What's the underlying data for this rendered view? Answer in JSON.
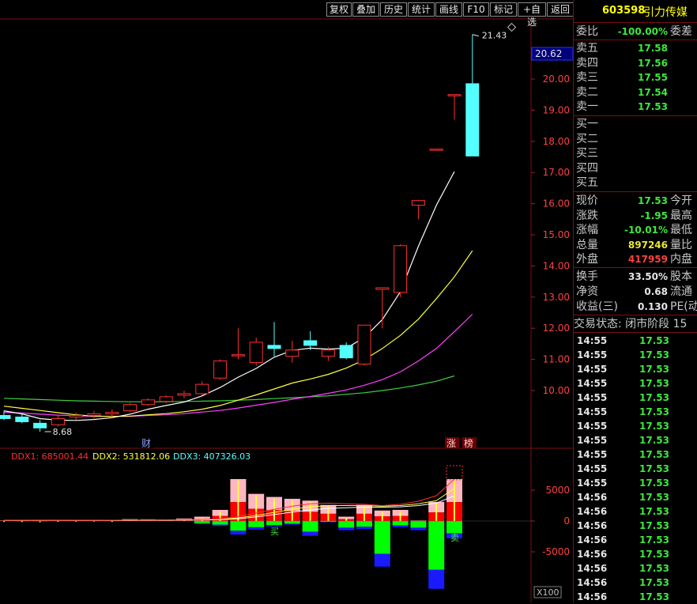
{
  "toolbar": {
    "buttons": [
      "复权",
      "叠加",
      "历史",
      "统计",
      "画线",
      "F10",
      "标记",
      "+自选",
      "返回"
    ]
  },
  "stock": {
    "code": "603598",
    "name": "引力传媒"
  },
  "price_axis": {
    "labels": [
      "20.00",
      "19.00",
      "18.00",
      "17.00",
      "16.00",
      "15.00",
      "14.00",
      "13.00",
      "12.00",
      "11.00",
      "10.00"
    ],
    "current_label": "20.62"
  },
  "chart_annotations": {
    "high_label": "21.43",
    "low_label": "8.68",
    "marker_cai": "财",
    "marker_zhang": "涨",
    "marker_bang": "榜",
    "buy_marker": "买",
    "sell_marker": "卖"
  },
  "ddx": {
    "ddx1_label": "DDX1: 685001.44",
    "ddx2_label": "DDX2: 531812.06",
    "ddx3_label": "DDX3: 407326.03",
    "axis_labels": [
      "5000",
      "0",
      "-5000"
    ],
    "scale_label": "X100"
  },
  "colors": {
    "up": "#ff3030",
    "down": "#54ffff",
    "ma5": "#ffffff",
    "ma10": "#ffff40",
    "ma20": "#ff40ff",
    "ma60": "#40d040",
    "ddx_up_dark": "#ff0000",
    "ddx_up_light": "#ffb6c1",
    "ddx_dn_dark": "#1a1aff",
    "ddx_dn_light": "#00ff00"
  },
  "chart_data": {
    "type": "candlestick",
    "candles": [
      {
        "o": 9.2,
        "h": 9.35,
        "l": 9.05,
        "c": 9.1
      },
      {
        "o": 9.15,
        "h": 9.25,
        "l": 8.95,
        "c": 9.0
      },
      {
        "o": 8.95,
        "h": 9.05,
        "l": 8.68,
        "c": 8.8
      },
      {
        "o": 8.9,
        "h": 9.2,
        "l": 8.85,
        "c": 9.1
      },
      {
        "o": 9.15,
        "h": 9.3,
        "l": 9.05,
        "c": 9.2
      },
      {
        "o": 9.2,
        "h": 9.35,
        "l": 9.1,
        "c": 9.25
      },
      {
        "o": 9.25,
        "h": 9.4,
        "l": 9.15,
        "c": 9.3
      },
      {
        "o": 9.35,
        "h": 9.6,
        "l": 9.3,
        "c": 9.55
      },
      {
        "o": 9.55,
        "h": 9.75,
        "l": 9.5,
        "c": 9.7
      },
      {
        "o": 9.65,
        "h": 9.85,
        "l": 9.6,
        "c": 9.8
      },
      {
        "o": 9.85,
        "h": 10.0,
        "l": 9.75,
        "c": 9.9
      },
      {
        "o": 9.9,
        "h": 10.3,
        "l": 9.85,
        "c": 10.2
      },
      {
        "o": 10.4,
        "h": 11.0,
        "l": 10.35,
        "c": 10.95
      },
      {
        "o": 11.15,
        "h": 12.0,
        "l": 11.0,
        "c": 11.15
      },
      {
        "o": 10.9,
        "h": 11.7,
        "l": 10.8,
        "c": 11.55
      },
      {
        "o": 11.45,
        "h": 12.2,
        "l": 11.1,
        "c": 11.35
      },
      {
        "o": 11.1,
        "h": 11.6,
        "l": 10.9,
        "c": 11.3
      },
      {
        "o": 11.6,
        "h": 11.9,
        "l": 11.3,
        "c": 11.45
      },
      {
        "o": 11.1,
        "h": 11.4,
        "l": 10.95,
        "c": 11.3
      },
      {
        "o": 11.45,
        "h": 11.55,
        "l": 11.0,
        "c": 11.05
      },
      {
        "o": 10.85,
        "h": 12.1,
        "l": 10.8,
        "c": 12.1
      },
      {
        "o": 13.25,
        "h": 13.3,
        "l": 12.0,
        "c": 13.3
      },
      {
        "o": 13.15,
        "h": 14.7,
        "l": 13.0,
        "c": 14.65
      },
      {
        "o": 15.95,
        "h": 16.1,
        "l": 15.5,
        "c": 16.1
      },
      {
        "o": 17.75,
        "h": 17.75,
        "l": 17.75,
        "c": 17.75
      },
      {
        "o": 19.5,
        "h": 19.5,
        "l": 18.7,
        "c": 19.5
      },
      {
        "o": 19.85,
        "h": 21.43,
        "l": 17.53,
        "c": 17.53
      }
    ],
    "ma5": [
      9.35,
      9.25,
      9.1,
      9.05,
      9.04,
      9.07,
      9.13,
      9.24,
      9.4,
      9.52,
      9.63,
      9.83,
      10.1,
      10.43,
      10.71,
      11.07,
      11.29,
      11.36,
      11.33,
      11.36,
      11.7,
      12.28,
      13.17,
      14.63,
      15.95,
      17.03
    ],
    "ma10": [
      9.5,
      9.43,
      9.36,
      9.29,
      9.22,
      9.18,
      9.17,
      9.18,
      9.22,
      9.26,
      9.32,
      9.4,
      9.52,
      9.69,
      9.86,
      10.05,
      10.24,
      10.37,
      10.52,
      10.72,
      10.99,
      11.35,
      11.77,
      12.29,
      12.95,
      13.65,
      14.49
    ],
    "ma20": [
      9.3,
      9.28,
      9.24,
      9.21,
      9.19,
      9.17,
      9.17,
      9.17,
      9.2,
      9.22,
      9.26,
      9.31,
      9.36,
      9.44,
      9.53,
      9.62,
      9.72,
      9.81,
      9.91,
      10.02,
      10.17,
      10.35,
      10.6,
      10.95,
      11.35,
      11.89,
      12.45
    ],
    "ma60": [
      9.75,
      9.73,
      9.71,
      9.69,
      9.67,
      9.66,
      9.65,
      9.64,
      9.64,
      9.64,
      9.65,
      9.66,
      9.67,
      9.69,
      9.71,
      9.74,
      9.77,
      9.8,
      9.83,
      9.88,
      9.93,
      10.0,
      10.08,
      10.18,
      10.3,
      10.47
    ],
    "ddx_bars": [
      {
        "up": 100,
        "dn": 0
      },
      {
        "up": 80,
        "dn": -40
      },
      {
        "up": 60,
        "dn": -60
      },
      {
        "up": 120,
        "dn": 0
      },
      {
        "up": 140,
        "dn": 0
      },
      {
        "up": 150,
        "dn": 0
      },
      {
        "up": 100,
        "dn": -20
      },
      {
        "up": 300,
        "dn": 0
      },
      {
        "up": 280,
        "dn": 0
      },
      {
        "up": 260,
        "dn": 0
      },
      {
        "up": 400,
        "dn": 0
      },
      {
        "up": 700,
        "dn": -500
      },
      {
        "up": 1800,
        "dn": -800
      },
      {
        "up": 6800,
        "dn": -2200
      },
      {
        "up": 4400,
        "dn": -1400
      },
      {
        "up": 3900,
        "dn": -900
      },
      {
        "up": 3600,
        "dn": -600
      },
      {
        "up": 3300,
        "dn": -2400
      },
      {
        "up": 2600,
        "dn": -200
      },
      {
        "up": 700,
        "dn": -1500
      },
      {
        "up": 2600,
        "dn": -1300
      },
      {
        "up": 1700,
        "dn": -7400
      },
      {
        "up": 1800,
        "dn": -1000
      },
      {
        "up": 100,
        "dn": -1500
      },
      {
        "up": 3100,
        "dn": -11000
      },
      {
        "up": 6800,
        "dn": -2800
      }
    ],
    "ddx1": [
      120,
      110,
      100,
      105,
      110,
      120,
      130,
      150,
      170,
      190,
      220,
      260,
      350,
      700,
      1300,
      1900,
      2400,
      2800,
      2900,
      2800,
      2700,
      2500,
      2700,
      3200,
      4100,
      6800
    ],
    "ddx2": [
      100,
      95,
      95,
      100,
      105,
      110,
      115,
      125,
      140,
      160,
      180,
      200,
      250,
      500,
      900,
      1400,
      1900,
      2300,
      2500,
      2500,
      2500,
      2400,
      2500,
      2800,
      3300,
      5300
    ],
    "ddx3": [
      90,
      90,
      90,
      92,
      95,
      98,
      100,
      105,
      115,
      125,
      140,
      160,
      200,
      350,
      650,
      1050,
      1450,
      1800,
      2050,
      2150,
      2250,
      2250,
      2300,
      2500,
      2900,
      4100
    ]
  },
  "panel": {
    "weibi_label": "委比",
    "weibi_value": "-100.00%",
    "weicha_label": "委差",
    "sell": [
      {
        "label": "卖五",
        "price": "17.58"
      },
      {
        "label": "卖四",
        "price": "17.56"
      },
      {
        "label": "卖三",
        "price": "17.55"
      },
      {
        "label": "卖二",
        "price": "17.54"
      },
      {
        "label": "卖一",
        "price": "17.53"
      }
    ],
    "buy": [
      {
        "label": "买一"
      },
      {
        "label": "买二"
      },
      {
        "label": "买三"
      },
      {
        "label": "买四"
      },
      {
        "label": "买五"
      }
    ],
    "quote": [
      {
        "label": "现价",
        "value": "17.53",
        "label2": "今开",
        "color": "green"
      },
      {
        "label": "涨跌",
        "value": "-1.95",
        "label2": "最高",
        "color": "green"
      },
      {
        "label": "涨幅",
        "value": "-10.01%",
        "label2": "最低",
        "color": "green"
      },
      {
        "label": "总量",
        "value": "897246",
        "label2": "量比",
        "color": "yellow"
      },
      {
        "label": "外盘",
        "value": "417959",
        "label2": "内盘",
        "color": "red"
      }
    ],
    "fin": [
      {
        "label": "换手",
        "value": "33.50%",
        "label2": "股本",
        "color": "white"
      },
      {
        "label": "净资",
        "value": "0.68",
        "label2": "流通",
        "color": "white"
      },
      {
        "label": "收益(三)",
        "value": "0.130",
        "label2": "PE(动",
        "color": "white"
      }
    ],
    "trade_status": "交易状态: 闭市阶段 15",
    "ticks": [
      {
        "time": "14:55",
        "price": "17.53"
      },
      {
        "time": "14:55",
        "price": "17.53"
      },
      {
        "time": "14:55",
        "price": "17.53"
      },
      {
        "time": "14:55",
        "price": "17.53"
      },
      {
        "time": "14:55",
        "price": "17.53"
      },
      {
        "time": "14:55",
        "price": "17.53"
      },
      {
        "time": "14:55",
        "price": "17.53"
      },
      {
        "time": "14:55",
        "price": "17.53"
      },
      {
        "time": "14:55",
        "price": "17.53"
      },
      {
        "time": "14:55",
        "price": "17.53"
      },
      {
        "time": "14:55",
        "price": "17.53"
      },
      {
        "time": "14:56",
        "price": "17.53"
      },
      {
        "time": "14:56",
        "price": "17.53"
      },
      {
        "time": "14:56",
        "price": "17.53"
      },
      {
        "time": "14:56",
        "price": "17.53"
      },
      {
        "time": "14:56",
        "price": "17.53"
      },
      {
        "time": "14:56",
        "price": "17.53"
      },
      {
        "time": "14:56",
        "price": "17.53"
      },
      {
        "time": "14:56",
        "price": "17.53"
      }
    ]
  }
}
